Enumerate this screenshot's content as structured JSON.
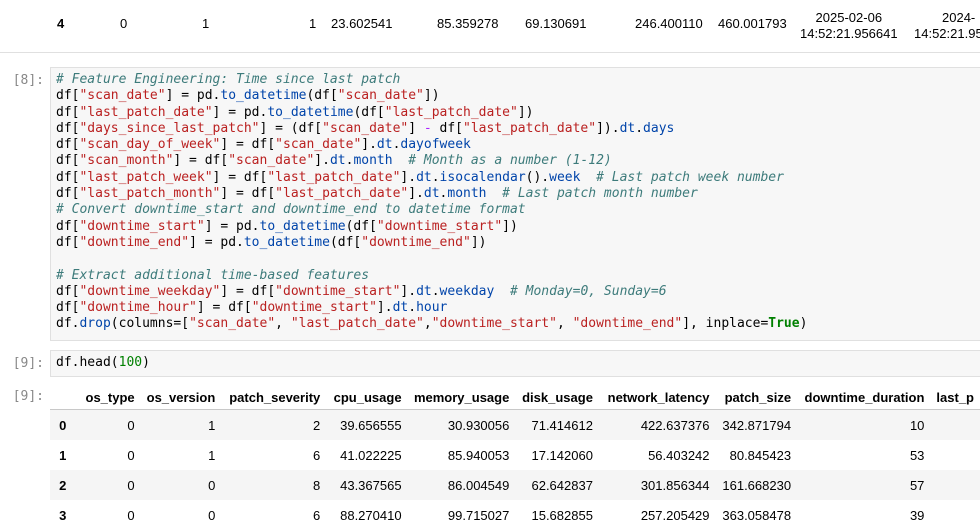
{
  "top_row": {
    "index": "4",
    "cells": [
      "0",
      "1",
      "1",
      "23.602541",
      "85.359278",
      "69.130691",
      "246.400110",
      "460.001793"
    ],
    "datetime1": [
      "2025-02-06",
      "14:52:21.956641"
    ],
    "datetime2": [
      "2024-",
      "14:52:21.95"
    ]
  },
  "cell8": {
    "prompt": "[8]:"
  },
  "cell9": {
    "prompt": "[9]:",
    "code_fn": "df.head(",
    "code_arg": "100",
    "code_close": ")"
  },
  "output9": {
    "prompt": "[9]:",
    "columns": [
      "",
      "os_type",
      "os_version",
      "patch_severity",
      "cpu_usage",
      "memory_usage",
      "disk_usage",
      "network_latency",
      "patch_size",
      "downtime_duration",
      "last_p"
    ],
    "rows": [
      [
        "0",
        "0",
        "1",
        "2",
        "39.656555",
        "30.930056",
        "71.414612",
        "422.637376",
        "342.871794",
        "10",
        ""
      ],
      [
        "1",
        "0",
        "1",
        "6",
        "41.022225",
        "85.940053",
        "17.142060",
        "56.403242",
        "80.845423",
        "53",
        ""
      ],
      [
        "2",
        "0",
        "0",
        "8",
        "43.367565",
        "86.004549",
        "62.642837",
        "301.856344",
        "161.668230",
        "57",
        ""
      ],
      [
        "3",
        "0",
        "0",
        "6",
        "88.270410",
        "99.715027",
        "15.682855",
        "257.205429",
        "363.058478",
        "39",
        ""
      ]
    ]
  }
}
